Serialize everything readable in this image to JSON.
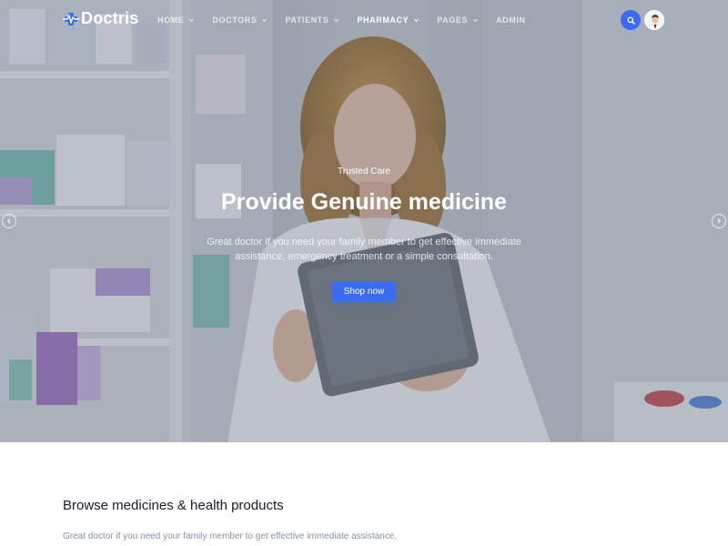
{
  "brand": {
    "name": "Doctris",
    "accent": "#396cf0"
  },
  "nav": {
    "items": [
      {
        "label": "HOME",
        "has_dropdown": true,
        "active": false
      },
      {
        "label": "DOCTORS",
        "has_dropdown": true,
        "active": false
      },
      {
        "label": "PATIENTS",
        "has_dropdown": true,
        "active": false
      },
      {
        "label": "PHARMACY",
        "has_dropdown": true,
        "active": true
      },
      {
        "label": "PAGES",
        "has_dropdown": true,
        "active": false
      },
      {
        "label": "ADMIN",
        "has_dropdown": false,
        "active": false
      }
    ],
    "search_icon": "search-icon",
    "avatar_icon": "user-avatar"
  },
  "hero": {
    "eyebrow": "Trusted Care",
    "title": "Provide Genuine medicine",
    "description": "Great doctor if you need your family member to get effective immediate assistance, emergency treatment or a simple consultation.",
    "cta_label": "Shop now",
    "prev_icon": "chevron-left-icon",
    "next_icon": "chevron-right-icon"
  },
  "section": {
    "title": "Browse medicines & health products",
    "description": "Great doctor if you need your family member to get effective immediate assistance,"
  }
}
